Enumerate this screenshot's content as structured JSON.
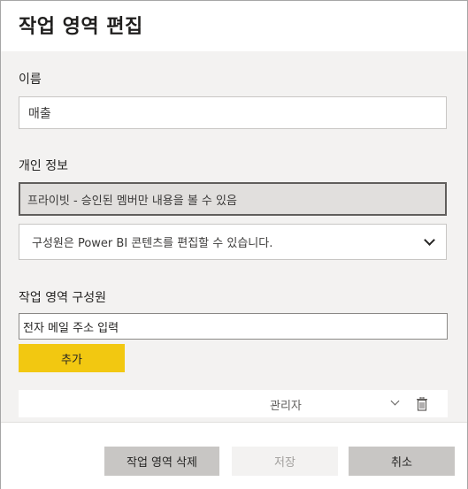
{
  "dialog": {
    "title": "작업 영역 편집"
  },
  "name_section": {
    "label": "이름",
    "value": "매출"
  },
  "privacy_section": {
    "label": "개인 정보",
    "privacy_value": "프라이빗 - 승인된 멤버만 내용을 볼 수 있음",
    "permission_value": "구성원은 Power BI 콘텐츠를 편집할 수 있습니다."
  },
  "members_section": {
    "label": "작업 영역 구성원",
    "email_placeholder": "전자 메일 주소 입력",
    "add_label": "추가",
    "members": [
      {
        "role": "관리자"
      }
    ]
  },
  "footer": {
    "delete_label": "작업 영역 삭제",
    "save_label": "저장",
    "cancel_label": "취소"
  },
  "colors": {
    "accent": "#f2c811",
    "panel": "#f3f2f1"
  }
}
